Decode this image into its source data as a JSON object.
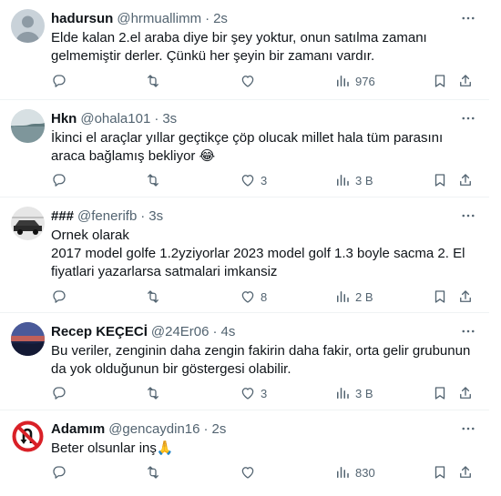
{
  "tweets": [
    {
      "name": "hadursun",
      "handle": "@hrmuallimm",
      "separator": "·",
      "time": "2s",
      "text": "Elde kalan 2.el araba diye bir şey yoktur, onun satılma zamanı gelmemiştir derler. Çünkü her şeyin bir zamanı vardır.",
      "likes": "",
      "views": "976",
      "avatar": "gray-person-avatar"
    },
    {
      "name": "Hkn",
      "handle": "@ohala101",
      "separator": "·",
      "time": "3s",
      "text": "İkinci el araçlar yıllar geçtikçe çöp olucak millet hala tüm parasını araca bağlamış bekliyor 😂",
      "likes": "3",
      "views": "3 B",
      "avatar": "seascape-avatar"
    },
    {
      "name": "###",
      "handle": "@fenerifb",
      "separator": "·",
      "time": "3s",
      "text_lines": [
        "Ornek olarak",
        "2017 model golfe 1.2yziyorlar 2023 model golf 1.3 boyle sacma 2. El fiyatlari yazarlarsa satmalari imkansiz"
      ],
      "likes": "8",
      "views": "2 B",
      "avatar": "car-sketch-avatar"
    },
    {
      "name": "Recep KEÇECİ",
      "handle": "@24Er06",
      "separator": "·",
      "time": "4s",
      "text": "Bu veriler, zenginin daha zengin fakirin daha fakir, orta gelir grubunun da yok olduğunun bir göstergesi olabilir.",
      "likes": "3",
      "views": "3 B",
      "avatar": "sunset-avatar"
    },
    {
      "name": "Adamım",
      "handle": "@gencaydin16",
      "separator": "·",
      "time": "2s",
      "text": "Beter olsunlar inş🙏",
      "likes": "",
      "views": "830",
      "avatar": "no-u-turn-sign-avatar"
    }
  ],
  "icons": [
    "more-icon",
    "reply-icon",
    "retweet-icon",
    "like-icon",
    "views-icon",
    "bookmark-icon",
    "share-icon"
  ],
  "colors": {
    "text": "#0f1419",
    "secondary": "#536471",
    "divider": "#eff3f4",
    "sign_red": "#d92027"
  }
}
